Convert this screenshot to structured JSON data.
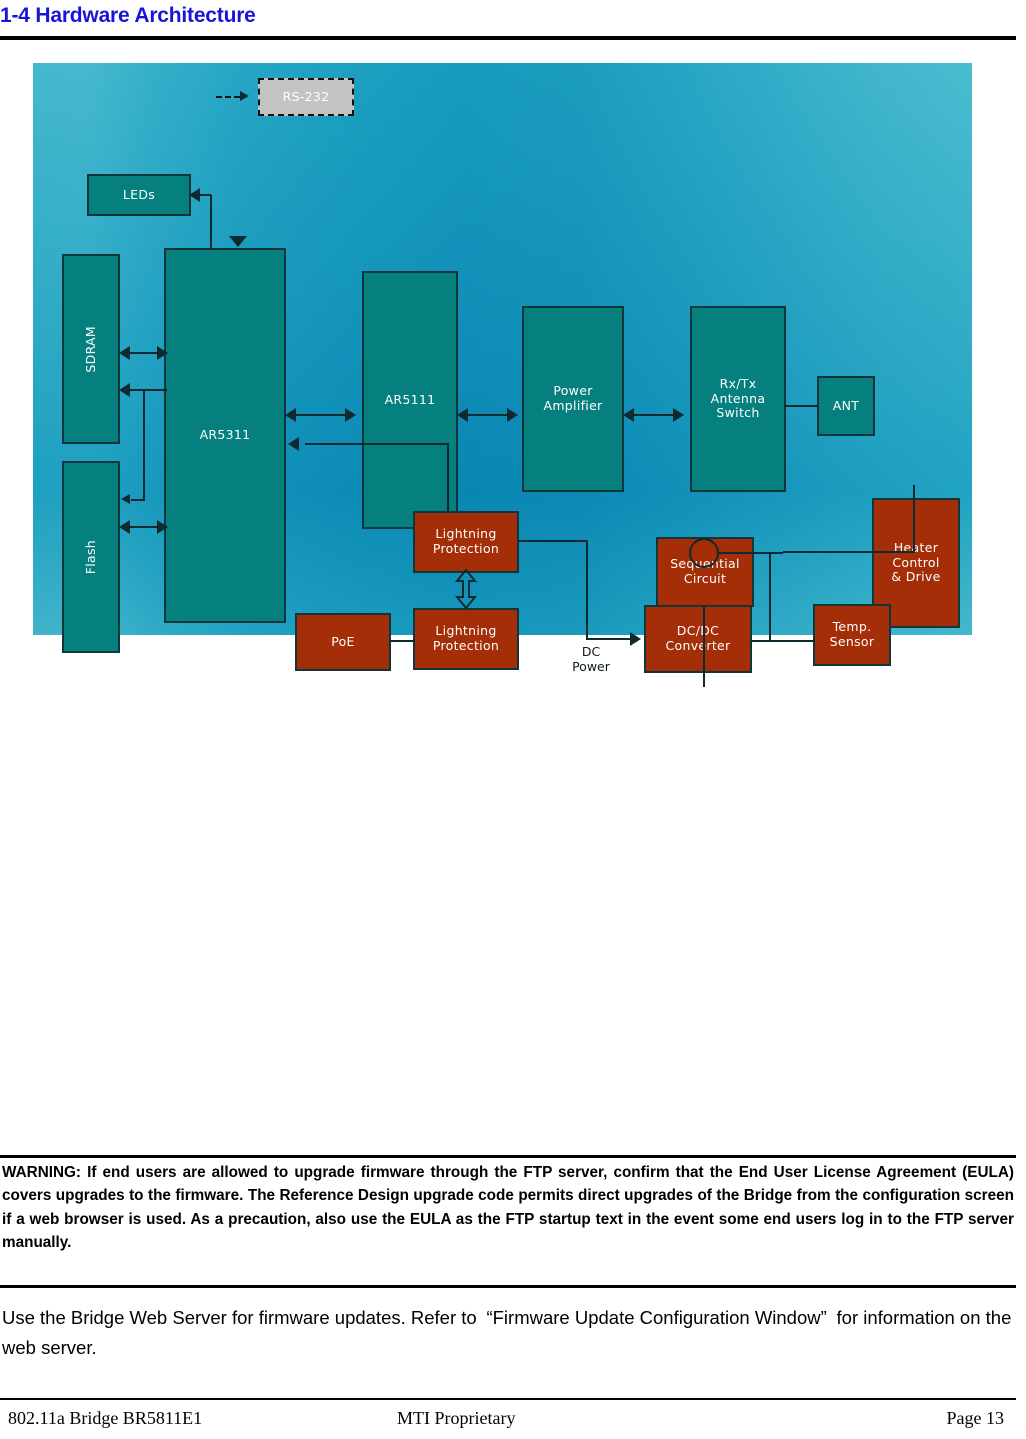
{
  "heading": "1-4 Hardware Architecture",
  "colors": {
    "heading": "#1616D8",
    "teal_block": "#05807F",
    "rust_block": "#A42E08",
    "dashed_block": "#C3C3C3",
    "wire": "#0C2A30",
    "diagram_bg_light": "#8ADBE6",
    "diagram_bg_dark": "#2CB4D3"
  },
  "diagram": {
    "title": "hardware-architecture-block-diagram",
    "nodes": [
      {
        "id": "rs232",
        "label": "RS-232",
        "style": "dashed"
      },
      {
        "id": "leds",
        "label": "LEDs",
        "style": "teal"
      },
      {
        "id": "sdram",
        "label": "SDRAM",
        "style": "teal",
        "rotated": true
      },
      {
        "id": "flash",
        "label": "Flash",
        "style": "teal",
        "rotated": true
      },
      {
        "id": "ar5311",
        "label": "AR5311",
        "style": "teal"
      },
      {
        "id": "ar5111",
        "label": "AR5111",
        "style": "teal"
      },
      {
        "id": "power_amp",
        "label": "Power\nAmplifier",
        "style": "teal"
      },
      {
        "id": "ant_switch",
        "label": "Rx/Tx\nAntenna\nSwitch",
        "style": "teal"
      },
      {
        "id": "ant",
        "label": "ANT",
        "style": "teal"
      },
      {
        "id": "seq_circuit",
        "label": "Sequential\nCircuit",
        "style": "rust"
      },
      {
        "id": "heater",
        "label": "Heater\nControl\n& Drive",
        "style": "rust"
      },
      {
        "id": "lp_upper",
        "label": "Lightning\nProtection",
        "style": "rust"
      },
      {
        "id": "lp_lower",
        "label": "Lightning\nProtection",
        "style": "rust"
      },
      {
        "id": "poe",
        "label": "PoE",
        "style": "rust"
      },
      {
        "id": "dcdc",
        "label": "DC/DC\nConverter",
        "style": "rust"
      },
      {
        "id": "temp_sensor",
        "label": "Temp.\nSensor",
        "style": "rust"
      }
    ],
    "free_labels": [
      {
        "id": "dc_power",
        "label": "DC\nPower"
      }
    ],
    "connections": [
      {
        "from": "ar5311",
        "to": "rs232",
        "kind": "dashed-arrow"
      },
      {
        "from": "ar5311",
        "to": "leds",
        "kind": "single-arrow"
      },
      {
        "from": "sdram",
        "to": "ar5311",
        "kind": "double-arrow"
      },
      {
        "from": "ar5311",
        "to": "sdram",
        "kind": "single-arrow"
      },
      {
        "from": "flash",
        "to": "ar5311",
        "kind": "double-arrow"
      },
      {
        "from": "ar5311",
        "to": "flash",
        "kind": "single-arrow"
      },
      {
        "from": "ar5311",
        "to": "ar5111",
        "kind": "double-arrow"
      },
      {
        "from": "ar5111",
        "to": "power_amp",
        "kind": "double-arrow"
      },
      {
        "from": "power_amp",
        "to": "ant_switch",
        "kind": "double-arrow"
      },
      {
        "from": "ant_switch",
        "to": "ant",
        "kind": "line"
      },
      {
        "from": "lp_upper",
        "to": "ar5311",
        "kind": "single-arrow"
      },
      {
        "from": "lp_lower",
        "to": "lp_upper",
        "kind": "hollow-double-arrow"
      },
      {
        "from": "poe",
        "to": "lp_lower",
        "kind": "line"
      },
      {
        "from": "lp_upper",
        "to": "dcdc",
        "kind": "single-arrow",
        "label": "DC Power"
      },
      {
        "from": "seq_circuit",
        "to": "junction",
        "kind": "line"
      },
      {
        "from": "junction",
        "to": "heater",
        "kind": "line"
      },
      {
        "from": "dcdc",
        "to": "temp_sensor",
        "kind": "line"
      }
    ]
  },
  "warning": {
    "text": "WARNING: If end users are allowed to upgrade firmware through the FTP server, confirm that the End User License Agreement (EULA) covers upgrades to the firmware. The Reference Design upgrade code permits direct upgrades of the Bridge from the configuration screen if a web browser is used. As a precaution, also use the EULA as the FTP startup text in the event some end users log in to the FTP server manually."
  },
  "body": {
    "paragraph": "Use the Bridge Web Server for firmware updates. Refer to  “Firmware Update Configuration Window”  for information on the web server."
  },
  "footer": {
    "left": "802.11a Bridge BR5811E1",
    "center": "MTI Proprietary",
    "right": "Page 13"
  }
}
